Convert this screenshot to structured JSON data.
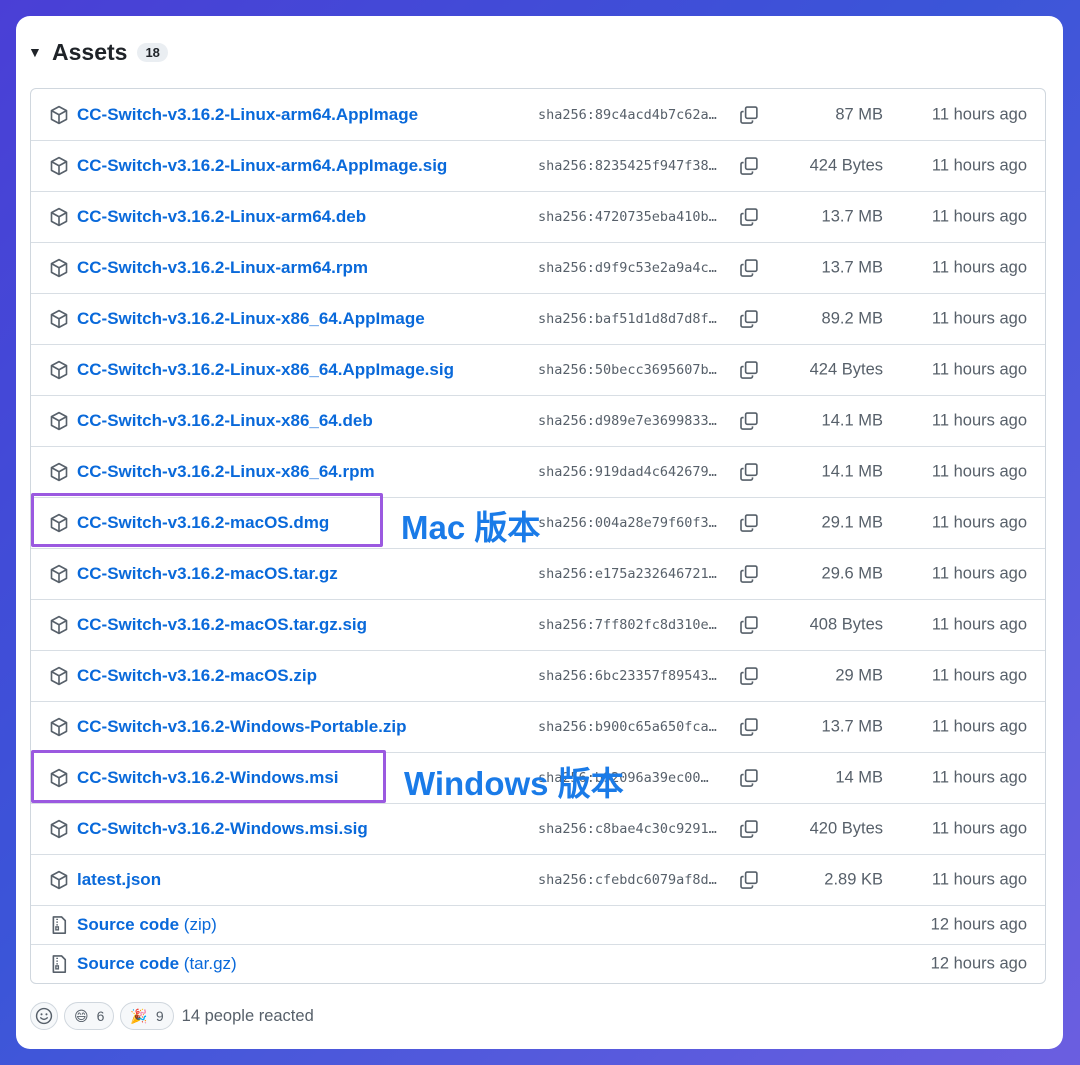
{
  "assets": {
    "title": "Assets",
    "count": "18",
    "caret": "▼",
    "rows": [
      {
        "name": "CC-Switch-v3.16.2-Linux-arm64.AppImage",
        "sha": "sha256:89c4acd4b7c62a…",
        "size": "87 MB",
        "time": "11 hours ago"
      },
      {
        "name": "CC-Switch-v3.16.2-Linux-arm64.AppImage.sig",
        "sha": "sha256:8235425f947f38…",
        "size": "424 Bytes",
        "time": "11 hours ago"
      },
      {
        "name": "CC-Switch-v3.16.2-Linux-arm64.deb",
        "sha": "sha256:4720735eba410b…",
        "size": "13.7 MB",
        "time": "11 hours ago"
      },
      {
        "name": "CC-Switch-v3.16.2-Linux-arm64.rpm",
        "sha": "sha256:d9f9c53e2a9a4c…",
        "size": "13.7 MB",
        "time": "11 hours ago"
      },
      {
        "name": "CC-Switch-v3.16.2-Linux-x86_64.AppImage",
        "sha": "sha256:baf51d1d8d7d8f…",
        "size": "89.2 MB",
        "time": "11 hours ago"
      },
      {
        "name": "CC-Switch-v3.16.2-Linux-x86_64.AppImage.sig",
        "sha": "sha256:50becc3695607b…",
        "size": "424 Bytes",
        "time": "11 hours ago"
      },
      {
        "name": "CC-Switch-v3.16.2-Linux-x86_64.deb",
        "sha": "sha256:d989e7e3699833…",
        "size": "14.1 MB",
        "time": "11 hours ago"
      },
      {
        "name": "CC-Switch-v3.16.2-Linux-x86_64.rpm",
        "sha": "sha256:919dad4c642679…",
        "size": "14.1 MB",
        "time": "11 hours ago"
      },
      {
        "name": "CC-Switch-v3.16.2-macOS.dmg",
        "sha": "sha256:004a28e79f60f3…",
        "size": "29.1 MB",
        "time": "11 hours ago"
      },
      {
        "name": "CC-Switch-v3.16.2-macOS.tar.gz",
        "sha": "sha256:e175a232646721…",
        "size": "29.6 MB",
        "time": "11 hours ago"
      },
      {
        "name": "CC-Switch-v3.16.2-macOS.tar.gz.sig",
        "sha": "sha256:7ff802fc8d310e…",
        "size": "408 Bytes",
        "time": "11 hours ago"
      },
      {
        "name": "CC-Switch-v3.16.2-macOS.zip",
        "sha": "sha256:6bc23357f89543…",
        "size": "29 MB",
        "time": "11 hours ago"
      },
      {
        "name": "CC-Switch-v3.16.2-Windows-Portable.zip",
        "sha": "sha256:b900c65a650fca…",
        "size": "13.7 MB",
        "time": "11 hours ago"
      },
      {
        "name": "CC-Switch-v3.16.2-Windows.msi",
        "sha": "sha256:b92096a39ec00…",
        "size": "14 MB",
        "time": "11 hours ago"
      },
      {
        "name": "CC-Switch-v3.16.2-Windows.msi.sig",
        "sha": "sha256:c8bae4c30c9291…",
        "size": "420 Bytes",
        "time": "11 hours ago"
      },
      {
        "name": "latest.json",
        "sha": "sha256:cfebdc6079af8d…",
        "size": "2.89 KB",
        "time": "11 hours ago"
      }
    ],
    "source_rows": [
      {
        "name": "Source code",
        "sub": "(zip)",
        "time": "12 hours ago"
      },
      {
        "name": "Source code",
        "sub": "(tar.gz)",
        "time": "12 hours ago"
      }
    ]
  },
  "annotations": {
    "mac": "Mac 版本",
    "windows": "Windows 版本",
    "highlight_color": "#9b59e0",
    "callout_color": "#1a7be8"
  },
  "reactions": {
    "items": [
      {
        "emoji": "😄",
        "count": "6"
      },
      {
        "emoji": "🎉",
        "count": "9"
      }
    ],
    "summary": "14 people reacted"
  },
  "colors": {
    "link": "#0969da",
    "muted": "#57606a",
    "border": "#d0d7de"
  },
  "icons": {
    "asset": "package-icon",
    "source": "file-zip-icon",
    "copy": "copy-icon",
    "react": "smiley-icon"
  }
}
